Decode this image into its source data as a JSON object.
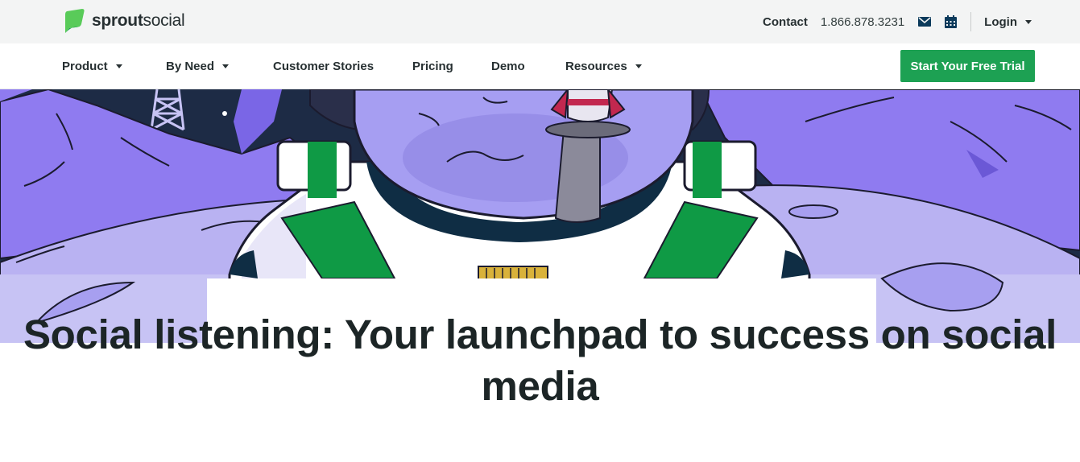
{
  "header": {
    "logo_text_bold": "sprout",
    "logo_text_light": "social",
    "contact_label": "Contact",
    "phone": "1.866.878.3231",
    "email_icon": "envelope-icon",
    "calendar_icon": "calendar-icon",
    "login_label": "Login"
  },
  "nav": {
    "items": [
      {
        "label": "Product",
        "dropdown": true
      },
      {
        "label": "By Need",
        "dropdown": true
      },
      {
        "label": "Customer Stories",
        "dropdown": false
      },
      {
        "label": "Pricing",
        "dropdown": false
      },
      {
        "label": "Demo",
        "dropdown": false
      },
      {
        "label": "Resources",
        "dropdown": true
      }
    ],
    "cta_label": "Start Your Free Trial"
  },
  "hero": {
    "title": "Social listening: Your launchpad to success on social media"
  },
  "colors": {
    "brand_green": "#1da153",
    "topbar_bg": "#f3f4f4",
    "text_dark": "#273032",
    "illustration_purple": "#9d8cf2",
    "illustration_lavender": "#c7c3f4"
  }
}
